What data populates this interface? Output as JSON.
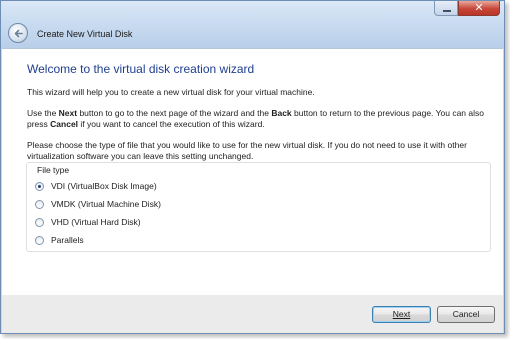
{
  "window": {
    "title": "Create New Virtual Disk",
    "controls": {
      "minimize": "–",
      "close": "✕"
    }
  },
  "content": {
    "heading": "Welcome to the virtual disk creation wizard",
    "para1": "This wizard will help you to create a new virtual disk for your virtual machine.",
    "para2": {
      "t1": "Use the ",
      "b1": "Next",
      "t2": " button to go to the next page of the wizard and the ",
      "b2": "Back",
      "t3": " button to return to the previous page. You can also press ",
      "b3": "Cancel",
      "t4": " if you want to cancel the execution of this wizard."
    },
    "para3": "Please choose the type of file that you would like to use for the new virtual disk. If you do not need to use it with other virtualization software you can leave this setting unchanged.",
    "file_type": {
      "title": "File type",
      "options": [
        {
          "label": "VDI (VirtualBox Disk Image)",
          "selected": true
        },
        {
          "label": "VMDK (Virtual Machine Disk)",
          "selected": false
        },
        {
          "label": "VHD (Virtual Hard Disk)",
          "selected": false
        },
        {
          "label": "Parallels",
          "selected": false
        }
      ]
    }
  },
  "footer": {
    "next_label": "Next",
    "cancel_label": "Cancel"
  },
  "colors": {
    "heading": "#1f3e8f",
    "titlebar": "#c9dcf1",
    "close_button": "#c7473a",
    "default_button_border": "#3c7fb1"
  },
  "icons": {
    "back": "back-arrow-icon",
    "minimize": "minimize-icon",
    "close": "close-icon"
  }
}
